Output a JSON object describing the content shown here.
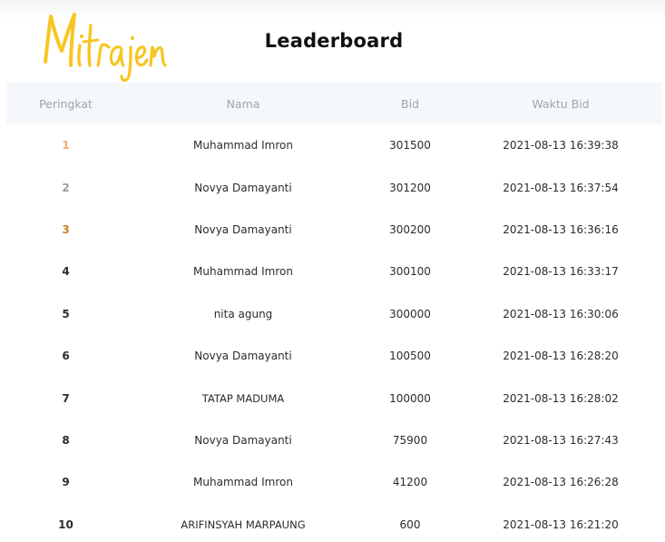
{
  "brand": {
    "logo_text": "Mitrajen",
    "logo_color": "#f7c623"
  },
  "header": {
    "title": "Leaderboard"
  },
  "table": {
    "columns": [
      "Peringkat",
      "Nama",
      "Bid",
      "Waktu Bid"
    ],
    "rows": [
      {
        "rank": "1",
        "name": "Muhammad Imron",
        "bid": "301500",
        "time": "2021-08-13 16:39:38"
      },
      {
        "rank": "2",
        "name": "Novya Damayanti",
        "bid": "301200",
        "time": "2021-08-13 16:37:54"
      },
      {
        "rank": "3",
        "name": "Novya Damayanti",
        "bid": "300200",
        "time": "2021-08-13 16:36:16"
      },
      {
        "rank": "4",
        "name": "Muhammad Imron",
        "bid": "300100",
        "time": "2021-08-13 16:33:17"
      },
      {
        "rank": "5",
        "name": "nita agung",
        "bid": "300000",
        "time": "2021-08-13 16:30:06"
      },
      {
        "rank": "6",
        "name": "Novya Damayanti",
        "bid": "100500",
        "time": "2021-08-13 16:28:20"
      },
      {
        "rank": "7",
        "name": "TATAP MADUMA",
        "bid": "100000",
        "time": "2021-08-13 16:28:02"
      },
      {
        "rank": "8",
        "name": "Novya Damayanti",
        "bid": "75900",
        "time": "2021-08-13 16:27:43"
      },
      {
        "rank": "9",
        "name": "Muhammad Imron",
        "bid": "41200",
        "time": "2021-08-13 16:26:28"
      },
      {
        "rank": "10",
        "name": "ARIFINSYAH MARPAUNG",
        "bid": "600",
        "time": "2021-08-13 16:21:20"
      }
    ]
  },
  "colors": {
    "rank_gold": "#f3a96a",
    "rank_silver": "#9c9c9c",
    "rank_bronze": "#cf8324",
    "header_bg": "#f5f8fa"
  }
}
